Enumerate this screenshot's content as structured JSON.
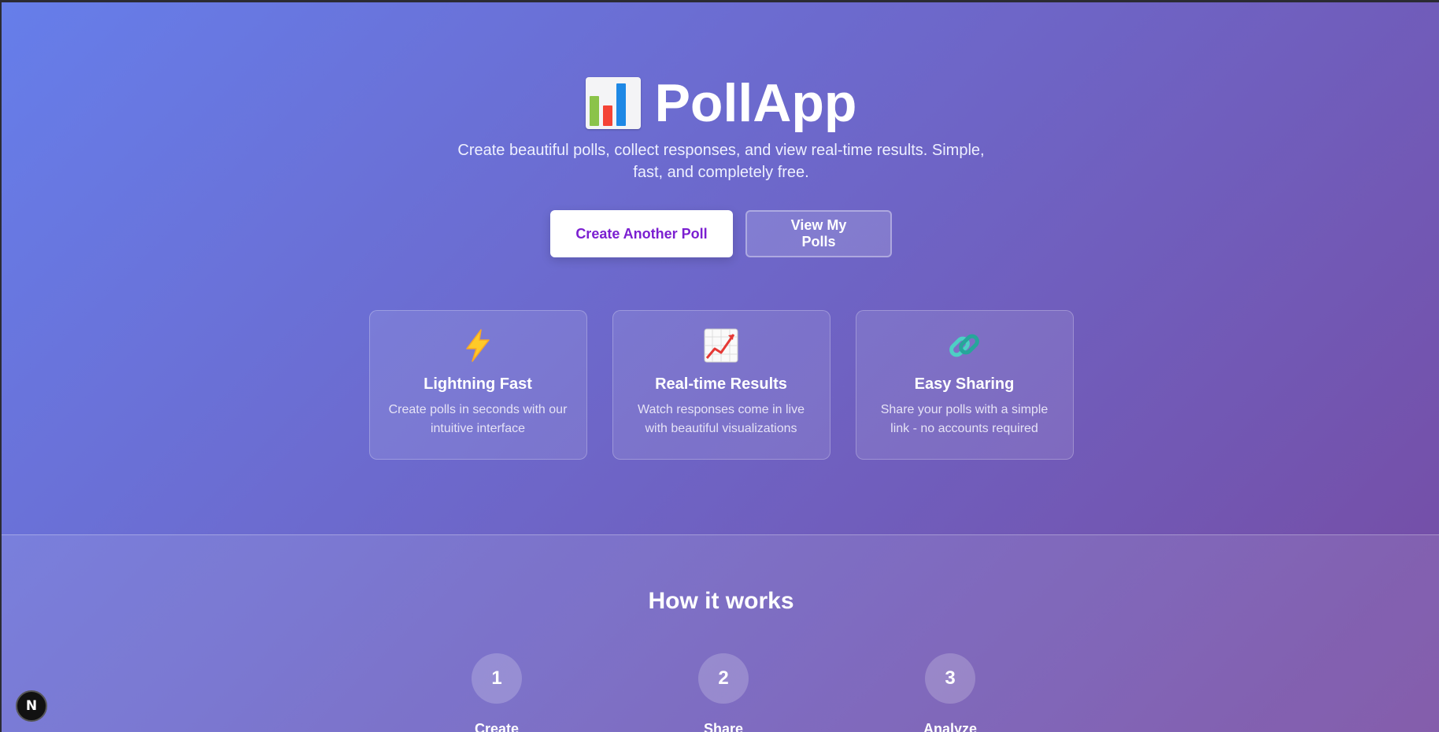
{
  "hero": {
    "app_name": "PollApp",
    "logo_icon": "bar-chart-emoji",
    "subtitle": "Create beautiful polls, collect responses, and view real-time results. Simple, fast, and completely free.",
    "primary_button": "Create Another Poll",
    "secondary_button": "View My Polls"
  },
  "features": [
    {
      "icon": "lightning-icon",
      "glyph": "⚡",
      "title": "Lightning Fast",
      "description": "Create polls in seconds with our intuitive interface"
    },
    {
      "icon": "chart-increasing-icon",
      "glyph": "📈",
      "title": "Real-time Results",
      "description": "Watch responses come in live with beautiful visualizations"
    },
    {
      "icon": "link-icon",
      "glyph": "🔗",
      "title": "Easy Sharing",
      "description": "Share your polls with a simple link - no accounts required"
    }
  ],
  "how_it_works": {
    "title": "How it works",
    "steps": [
      {
        "number": "1",
        "label": "Create"
      },
      {
        "number": "2",
        "label": "Share"
      },
      {
        "number": "3",
        "label": "Analyze"
      }
    ]
  },
  "dev_badge": {
    "label": "N"
  },
  "colors": {
    "gradient_start": "#667eea",
    "gradient_end": "#764ba2",
    "primary_button_text": "#7b1fd1"
  }
}
